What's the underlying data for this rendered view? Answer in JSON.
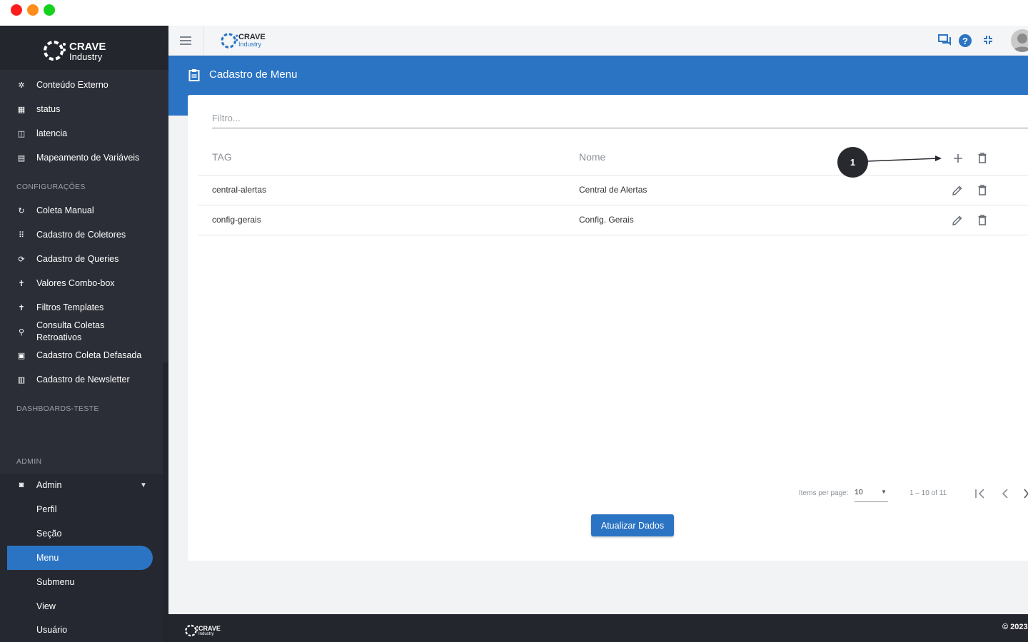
{
  "brand": {
    "name": "CRAVE",
    "tagline": "Industry"
  },
  "sidebar": {
    "items": [
      {
        "label": "Conteúdo Externo",
        "icon": "puzzle-icon"
      },
      {
        "label": "status",
        "icon": "dashboard-icon"
      },
      {
        "label": "latencia",
        "icon": "timer-icon"
      },
      {
        "label": "Mapeamento de Variáveis",
        "icon": "table-icon"
      }
    ],
    "section_config": "CONFIGURAÇÕES",
    "config_items": [
      {
        "label": "Coleta Manual",
        "icon": "refresh-icon"
      },
      {
        "label": "Cadastro de Coletores",
        "icon": "grid-icon"
      },
      {
        "label": "Cadastro de Queries",
        "icon": "sync-icon"
      },
      {
        "label": "Valores Combo-box",
        "icon": "accessibility-icon"
      },
      {
        "label": "Filtros Templates",
        "icon": "accessibility-icon"
      },
      {
        "label": "Consulta Coletas Retroativos",
        "icon": "search-icon"
      },
      {
        "label": "Cadastro Coleta Defasada",
        "icon": "storage-icon"
      },
      {
        "label": "Cadastro de Newsletter",
        "icon": "newspaper-icon"
      }
    ],
    "section_dash": "DASHBOARDS-TESTE",
    "section_admin": "ADMIN",
    "admin": {
      "label": "Admin",
      "icon": "admin-icon"
    },
    "admin_sub": [
      "Perfil",
      "Seção",
      "Menu",
      "Submenu",
      "View",
      "Usuário"
    ],
    "active": "Menu"
  },
  "page": {
    "title": "Cadastro de Menu"
  },
  "filter": {
    "placeholder": "Filtro..."
  },
  "table": {
    "headers": [
      "TAG",
      "Nome"
    ],
    "rows": [
      {
        "tag": "central-alertas",
        "nome": "Central de Alertas"
      },
      {
        "tag": "config-gerais",
        "nome": "Config. Gerais"
      }
    ]
  },
  "annotation": {
    "label": "1"
  },
  "paginator": {
    "items_per_page_label": "Items per page:",
    "page_size": "10",
    "range": "1 – 10 of 11"
  },
  "actions": {
    "update_label": "Atualizar Dados"
  },
  "footer": {
    "copyright": "© 2023"
  },
  "colors": {
    "primary": "#2b74c4",
    "sidebar": "#2b2e36",
    "dark": "#23262d"
  }
}
